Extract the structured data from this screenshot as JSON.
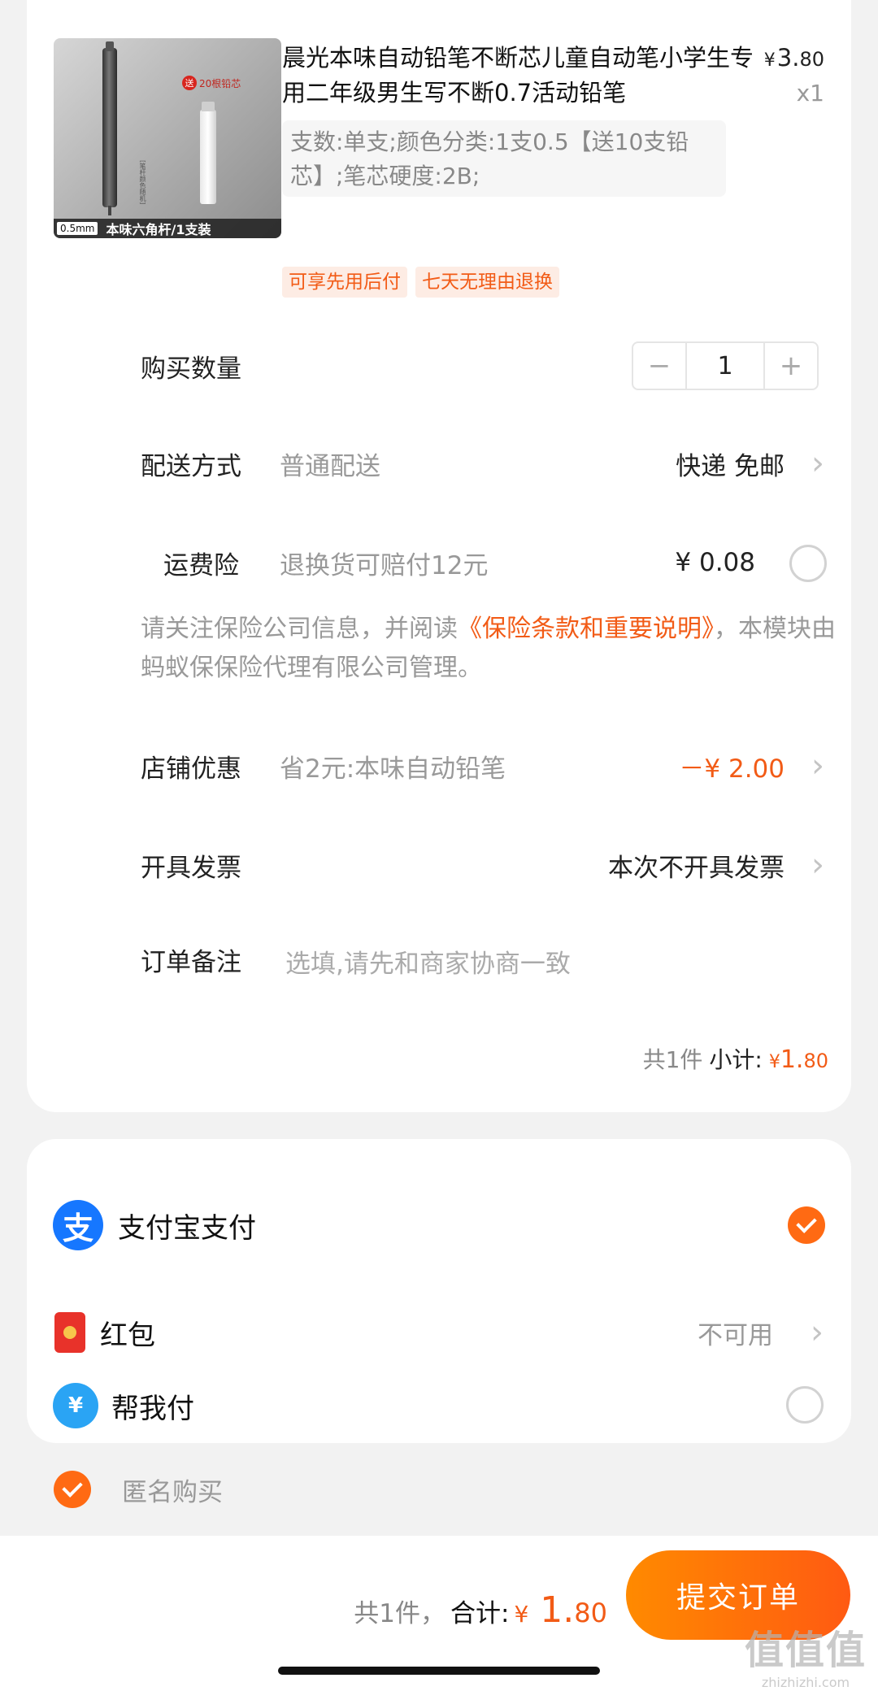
{
  "product": {
    "title": "晨光本味自动铅笔不断芯儿童自动笔小学生专用二年级男生写不断0.7活动铅笔",
    "price_symbol": "¥",
    "price_int": "3.",
    "price_dec": "80",
    "qty_label": "x1",
    "sku": "支数:单支;颜色分类:1支0.5【送10支铅芯】;笔芯硬度:2B;",
    "thumb": {
      "gift_badge": "送",
      "gift_text": "20根铅芯",
      "side_note": "[笔杆颜色随机]",
      "spec": "0.5mm",
      "caption": "本味六角杆/1支装"
    },
    "tags": [
      "可享先用后付",
      "七天无理由退换"
    ]
  },
  "quantity": {
    "label": "购买数量",
    "value": "1",
    "minus": "−",
    "plus": "+"
  },
  "delivery": {
    "label": "配送方式",
    "hint": "普通配送",
    "value": "快递 免邮"
  },
  "insurance": {
    "label": "运费险",
    "hint": "退换货可赔付12元",
    "value": "¥ 0.08"
  },
  "notice": {
    "prefix": "请关注保险公司信息，并阅读",
    "link": "《保险条款和重要说明》",
    "suffix": "，本模块由蚂蚁保保险代理有限公司管理。"
  },
  "shop_discount": {
    "label": "店铺优惠",
    "hint": "省2元:本味自动铅笔",
    "value": "－¥ 2.00"
  },
  "invoice": {
    "label": "开具发票",
    "value": "本次不开具发票"
  },
  "remark": {
    "label": "订单备注",
    "placeholder": "选填,请先和商家协商一致"
  },
  "subtotal": {
    "count": "共1件",
    "label": "小计:",
    "symbol": "¥",
    "int": "1.",
    "dec": "80"
  },
  "payment": {
    "alipay_icon": "支",
    "alipay_label": "支付宝支付",
    "hongbao_label": "红包",
    "hongbao_value": "不可用",
    "help_icon": "¥",
    "help_label": "帮我付"
  },
  "anonymous": {
    "label": "匿名购买"
  },
  "footer": {
    "count": "共1件，",
    "label": "合计:",
    "symbol": "¥",
    "int": "1.",
    "dec": "80",
    "submit": "提交订单"
  },
  "watermark": {
    "big": "值值值",
    "small": "zhizhizhi.com"
  },
  "colors": {
    "accent": "#f25b16",
    "submit_from": "#ff8a00",
    "submit_to": "#ff5a12",
    "alipay": "#1677ff"
  },
  "icons": {
    "chevron": "chevron-right-icon",
    "radio_off": "radio-unchecked-icon",
    "radio_on": "check-circle-icon"
  }
}
